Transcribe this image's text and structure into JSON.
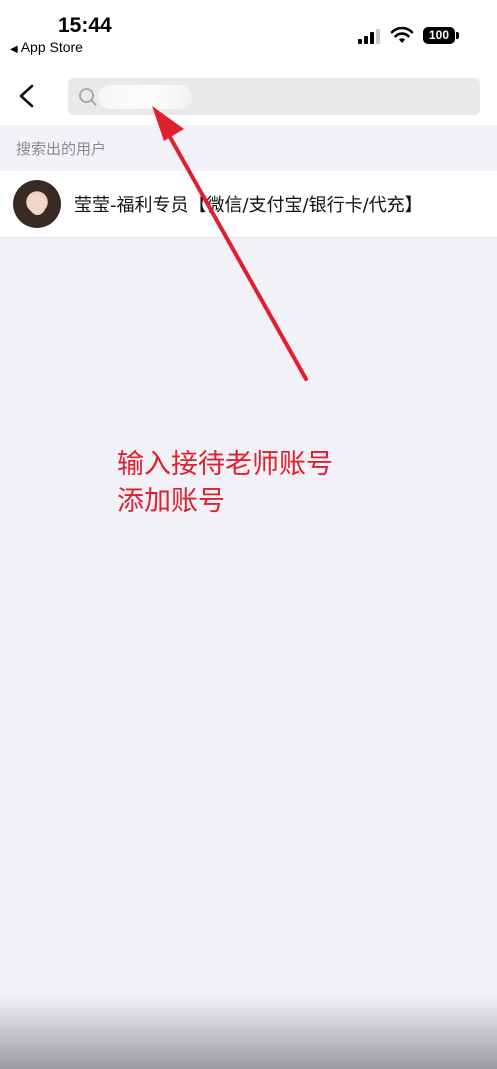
{
  "status_bar": {
    "time": "15:44",
    "back_app": "App Store",
    "battery": "100"
  },
  "nav": {
    "back_icon": "chevron-left-icon",
    "search": {
      "value": "",
      "placeholder": "",
      "icon": "search-icon"
    }
  },
  "results": {
    "section_title": "搜索出的用户",
    "users": [
      {
        "name": "莹莹-福利专员【微信/支付宝/银行卡/代充】"
      }
    ]
  },
  "annotation": {
    "lines": [
      "输入接待老师账号",
      "添加账号"
    ],
    "color": "#e0202e"
  }
}
